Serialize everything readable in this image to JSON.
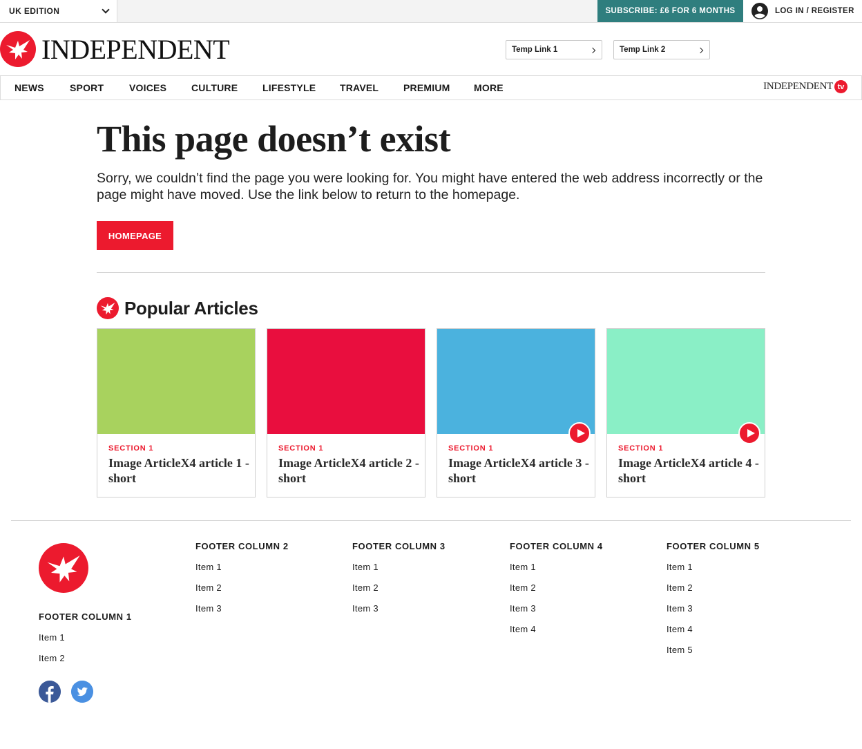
{
  "topbar": {
    "edition_label": "UK EDITION",
    "subscribe_label": "SUBSCRIBE: £6 FOR 6 MONTHS",
    "login_label": "LOG IN / REGISTER"
  },
  "header": {
    "logo_text": "INDEPENDENT",
    "temp_links": [
      "Temp Link 1",
      "Temp Link 2"
    ]
  },
  "nav": {
    "items": [
      "NEWS",
      "SPORT",
      "VOICES",
      "CULTURE",
      "LIFESTYLE",
      "TRAVEL",
      "PREMIUM",
      "MORE"
    ],
    "tv_text": "INDEPENDENT",
    "tv_badge": "tv"
  },
  "main": {
    "title": "This page doesn’t exist",
    "description": "Sorry, we couldn’t find the page you were looking for. You might have entered the web address incorrectly or the page might have moved. Use the link below to return to the homepage.",
    "home_button": "HOMEPAGE",
    "popular_title": "Popular Articles"
  },
  "articles": [
    {
      "section": "SECTION 1",
      "headline": "Image ArticleX4 article 1 - short",
      "color": "#a8d25e",
      "video": false
    },
    {
      "section": "SECTION 1",
      "headline": "Image ArticleX4 article 2 - short",
      "color": "#e90e3e",
      "video": false
    },
    {
      "section": "SECTION 1",
      "headline": "Image ArticleX4 article 3 - short",
      "color": "#4bb2de",
      "video": true
    },
    {
      "section": "SECTION 1",
      "headline": "Image ArticleX4 article 4 - short",
      "color": "#8aefc6",
      "video": true
    }
  ],
  "footer": {
    "columns": [
      {
        "title": "FOOTER COLUMN 1",
        "items": [
          "Item 1",
          "Item 2"
        ]
      },
      {
        "title": "FOOTER COLUMN 2",
        "items": [
          "Item 1",
          "Item 2",
          "Item 3"
        ]
      },
      {
        "title": "FOOTER COLUMN 3",
        "items": [
          "Item 1",
          "Item 2",
          "Item 3"
        ]
      },
      {
        "title": "FOOTER COLUMN 4",
        "items": [
          "Item 1",
          "Item 2",
          "Item 3",
          "Item 4"
        ]
      },
      {
        "title": "FOOTER COLUMN 5",
        "items": [
          "Item 1",
          "Item 2",
          "Item 3",
          "Item 4",
          "Item 5"
        ]
      }
    ],
    "social": [
      "facebook-icon",
      "twitter-icon"
    ]
  },
  "colors": {
    "brand_red": "#ec1a2e",
    "subscribe_teal": "#2f7e7e"
  }
}
